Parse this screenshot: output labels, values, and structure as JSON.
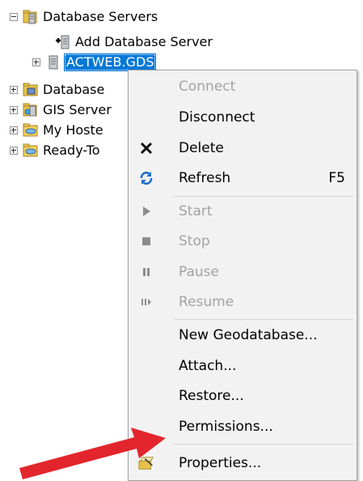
{
  "tree": {
    "database_servers": "Database Servers",
    "add_database_server": "Add Database Server",
    "selected_server": "ACTWEB.GDS",
    "database_connections": "Database",
    "gis_servers": "GIS Server",
    "my_hosted": "My Hoste",
    "ready_to_use": "Ready-To"
  },
  "context_menu": {
    "items": [
      {
        "label": "Connect",
        "enabled": false,
        "icon": ""
      },
      {
        "label": "Disconnect",
        "enabled": true,
        "icon": ""
      },
      {
        "label": "Delete",
        "enabled": true,
        "icon": "delete-x-icon"
      },
      {
        "label": "Refresh",
        "enabled": true,
        "icon": "refresh-icon",
        "shortcut": "F5"
      },
      {
        "label": "Start",
        "enabled": false,
        "icon": "start-icon"
      },
      {
        "label": "Stop",
        "enabled": false,
        "icon": "stop-icon"
      },
      {
        "label": "Pause",
        "enabled": false,
        "icon": "pause-icon"
      },
      {
        "label": "Resume",
        "enabled": false,
        "icon": "resume-icon"
      },
      {
        "label": "New Geodatabase...",
        "enabled": true,
        "icon": ""
      },
      {
        "label": "Attach...",
        "enabled": true,
        "icon": ""
      },
      {
        "label": "Restore...",
        "enabled": true,
        "icon": ""
      },
      {
        "label": "Permissions...",
        "enabled": true,
        "icon": ""
      },
      {
        "label": "Properties...",
        "enabled": true,
        "icon": "properties-icon"
      }
    ]
  },
  "colors": {
    "selection": "#0078d7",
    "arrow": "#e2252d",
    "menu_bg": "#f2f2f2",
    "disabled_text": "#a3a3a3"
  }
}
